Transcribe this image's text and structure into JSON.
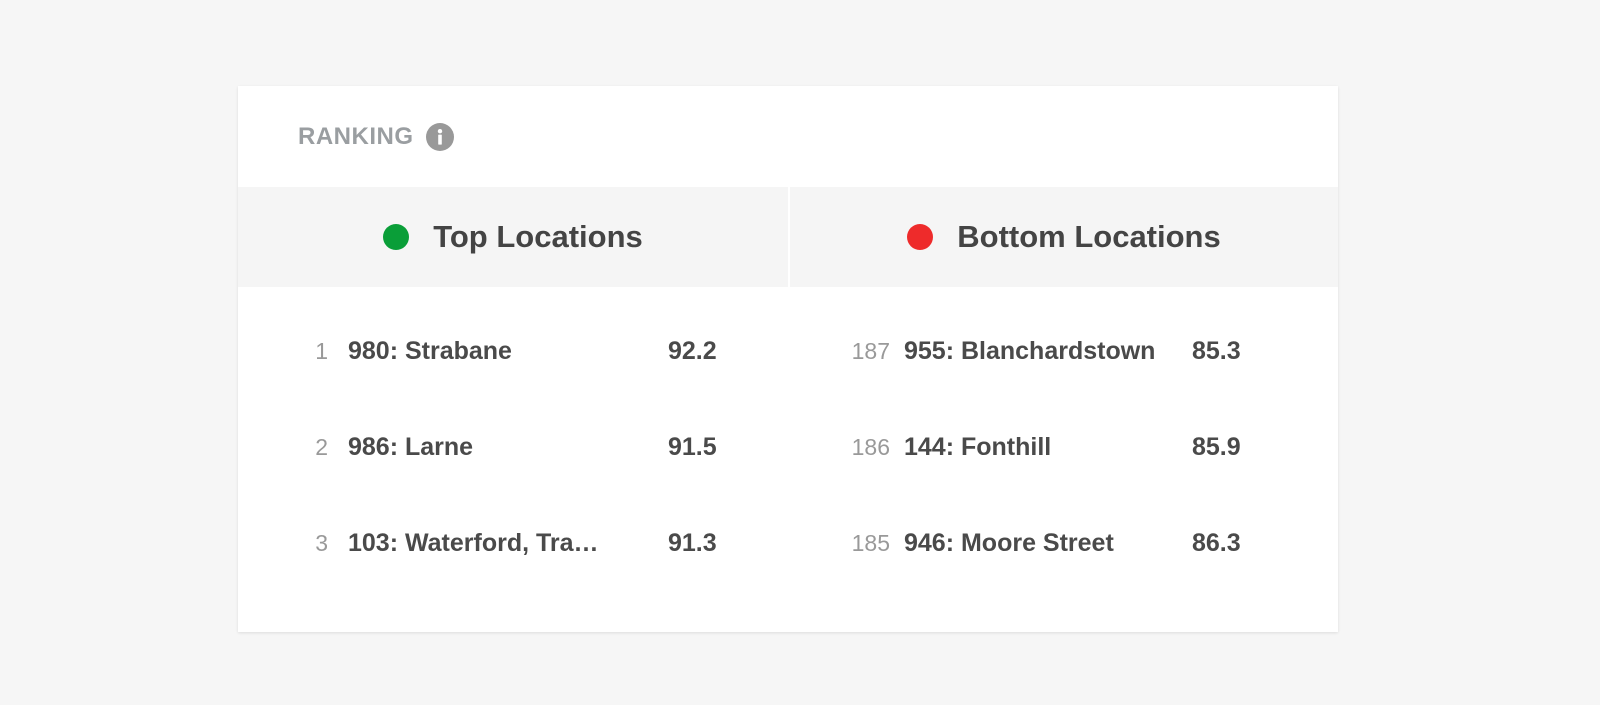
{
  "card": {
    "title": "RANKING",
    "info_icon": "info-icon"
  },
  "colors": {
    "top_dot": "#0a9e38",
    "bottom_dot": "#ee2b2b"
  },
  "top": {
    "title": "Top Locations",
    "rows": [
      {
        "rank": "1",
        "name": "980: Strabane",
        "score": "92.2"
      },
      {
        "rank": "2",
        "name": "986:  Larne",
        "score": "91.5"
      },
      {
        "rank": "3",
        "name": "103: Waterford, Tra…",
        "score": "91.3"
      }
    ]
  },
  "bottom": {
    "title": "Bottom Locations",
    "rows": [
      {
        "rank": "187",
        "name": "955: Blanchardstown",
        "score": "85.3"
      },
      {
        "rank": "186",
        "name": "144: Fonthill",
        "score": "85.9"
      },
      {
        "rank": "185",
        "name": "946: Moore Street",
        "score": "86.3"
      }
    ]
  }
}
